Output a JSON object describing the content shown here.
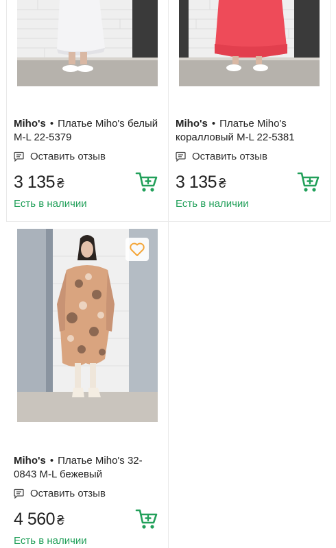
{
  "products": [
    {
      "brand": "Miho's",
      "separator": "•",
      "name_line1": "Платье Miho's белый",
      "name_line2": "M-L 22-5379",
      "review_label": "Оставить отзыв",
      "price": "3 135",
      "currency": "₴",
      "stock": "Есть в наличии",
      "image": "dress-white-photo"
    },
    {
      "brand": "Miho's",
      "separator": "•",
      "name_line1": "Платье Miho's",
      "name_line2": "коралловый M-L 22-5381",
      "review_label": "Оставить отзыв",
      "price": "3 135",
      "currency": "₴",
      "stock": "Есть в наличии",
      "image": "dress-coral-photo"
    },
    {
      "brand": "Miho's",
      "separator": "•",
      "name_line1": "Платье Miho's 32-",
      "name_line2": "0843 M-L бежевый",
      "review_label": "Оставить отзыв",
      "price": "4 560",
      "currency": "₴",
      "stock": "Есть в наличии",
      "image": "dress-beige-paisley-photo"
    }
  ],
  "colors": {
    "accent_green": "#22a05a",
    "favorite_orange": "#f4a63a",
    "divider": "#e9e9e9"
  },
  "icons": {
    "review": "chat-bubble-icon",
    "cart": "shopping-cart-icon",
    "favorite": "heart-outline-icon"
  }
}
